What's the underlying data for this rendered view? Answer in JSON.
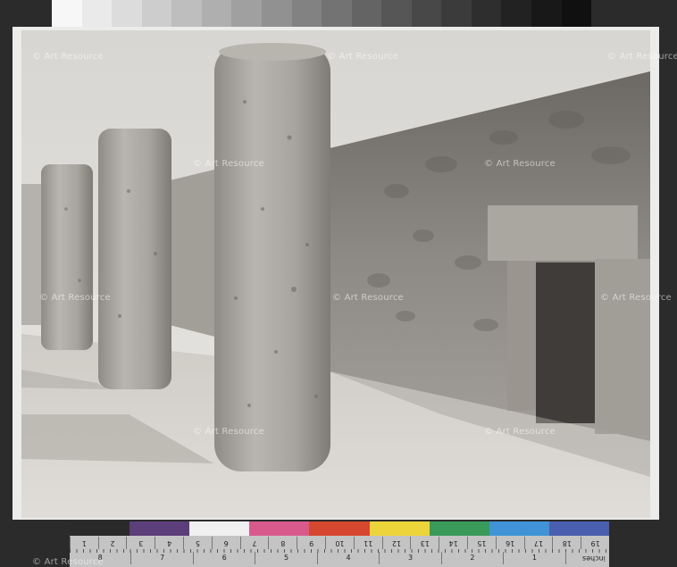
{
  "grayscale": [
    "#f7f7f7",
    "#eaeaea",
    "#dcdcdc",
    "#cdcdcd",
    "#bebebe",
    "#afafaf",
    "#a0a0a0",
    "#919191",
    "#828282",
    "#737373",
    "#646464",
    "#565656",
    "#484848",
    "#3b3b3b",
    "#2e2e2e",
    "#222222",
    "#181818",
    "#101010"
  ],
  "watermarks": [
    "© Art Resource",
    "© Art Resource",
    "© Art Resource",
    "© Art Resource",
    "© Art Resource",
    "© Art Resource",
    "© Art Resource",
    "© Art Resource",
    "© Art Resource",
    "© Art Resource",
    "© Art Resource"
  ],
  "color_card": {
    "swatches": [
      "#2a2a2a",
      "#5b3e7a",
      "#f0f0f0",
      "#d85a8c",
      "#d6472f",
      "#ecd53b",
      "#3a9a5a",
      "#3f93d6",
      "#4a5fb0"
    ],
    "inches_top": [
      "19",
      "18",
      "17",
      "16",
      "15",
      "14",
      "13",
      "12",
      "11",
      "10",
      "9",
      "8",
      "7",
      "6",
      "5",
      "4",
      "3",
      "2",
      "1"
    ],
    "inches_bottom": [
      "8",
      "7",
      "6",
      "5",
      "4",
      "3",
      "2",
      "1"
    ],
    "unit_label": "inches"
  }
}
